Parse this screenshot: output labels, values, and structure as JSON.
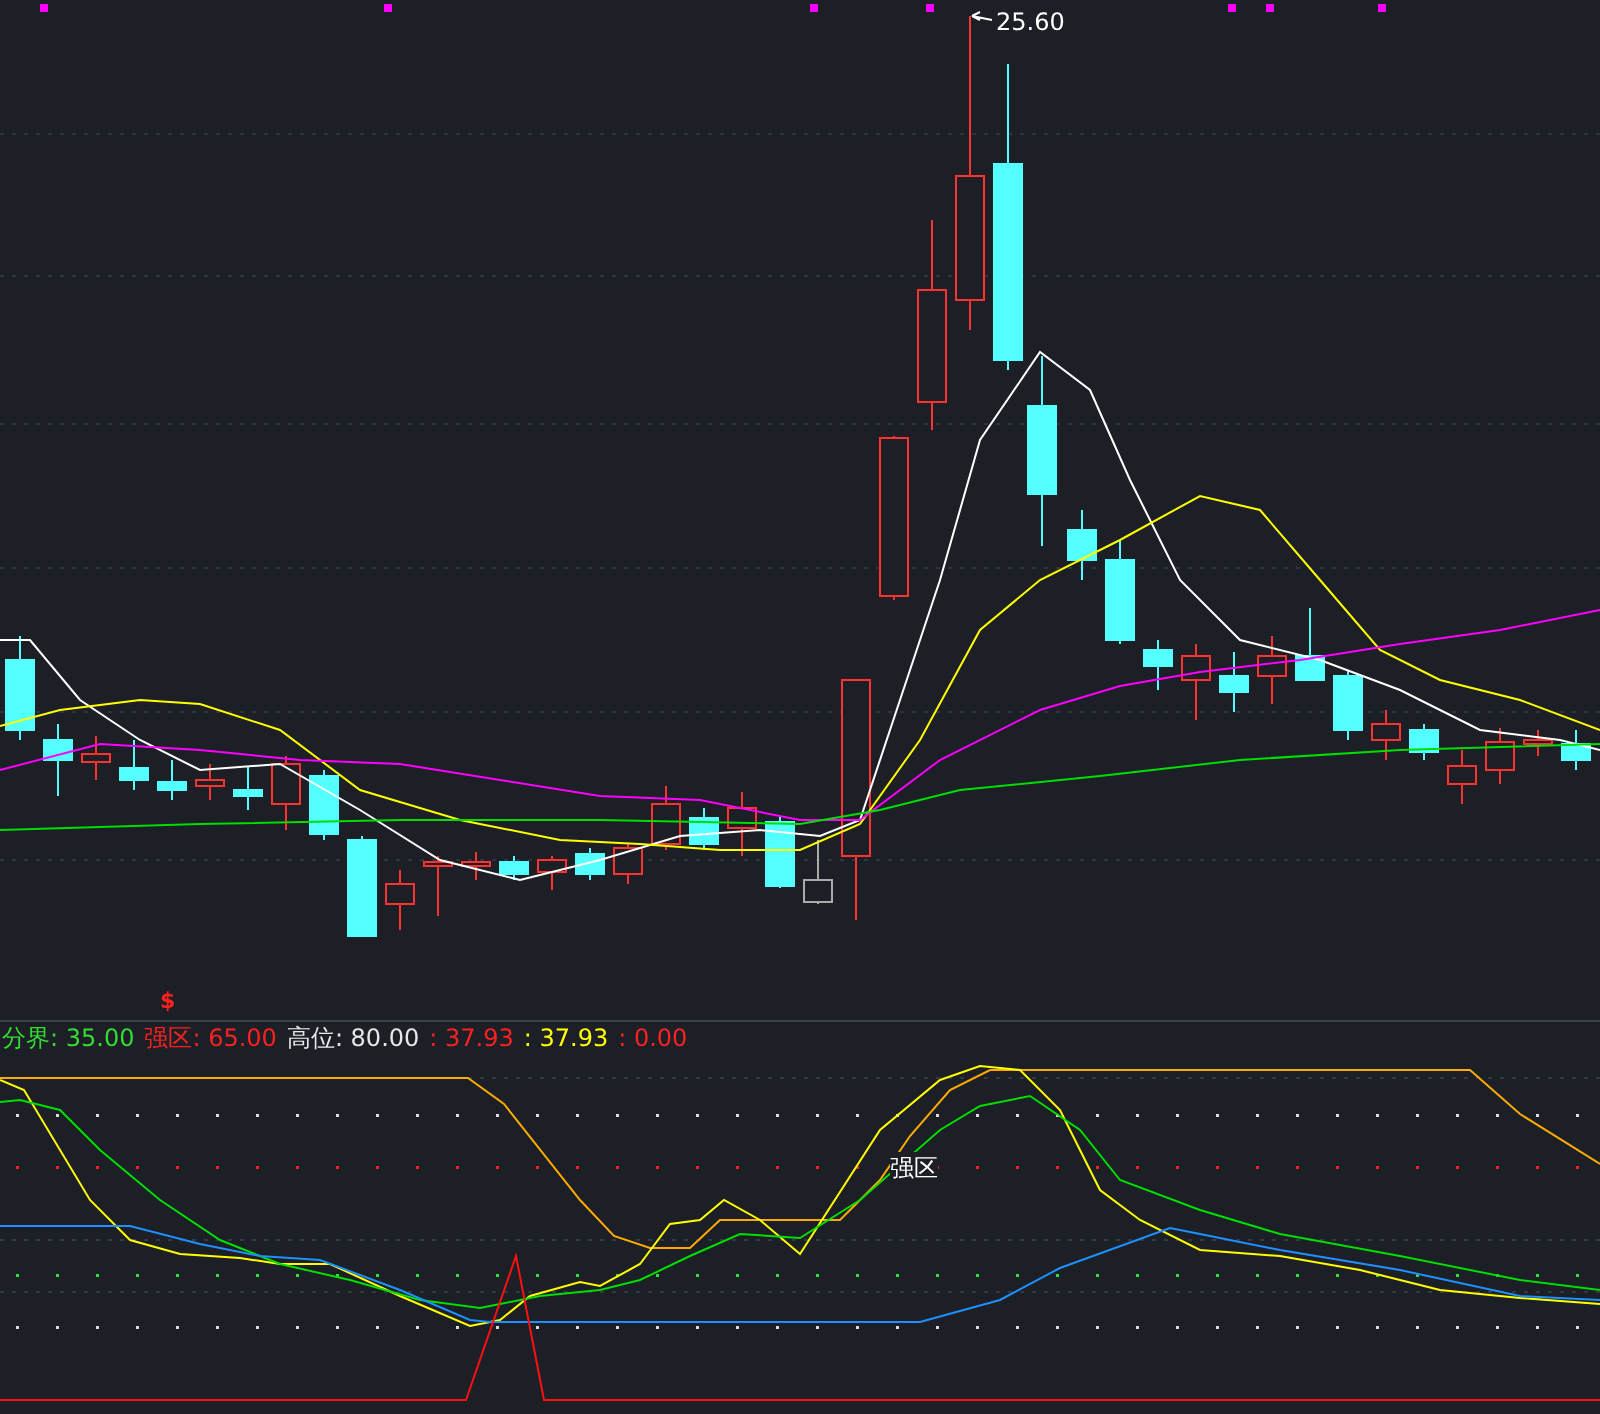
{
  "price_panel": {
    "high_label": "25.60",
    "signal_mark": "$"
  },
  "indicator_legend": [
    {
      "text": "分界: 35.00",
      "color": "#33dd33"
    },
    {
      "text": "强区: 65.00",
      "color": "#ff2020"
    },
    {
      "text": "高位: 80.00",
      "color": "#e8e8e8"
    },
    {
      "text": ": 37.93",
      "color": "#ff2020"
    },
    {
      "text": ": 37.93",
      "color": "#ffff00"
    },
    {
      "text": ": 0.00",
      "color": "#ff2020"
    }
  ],
  "indicator_panel": {
    "zone_label": "强区"
  }
}
